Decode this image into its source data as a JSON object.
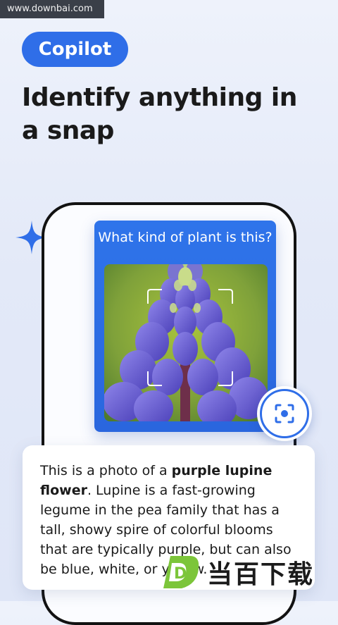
{
  "watermark": {
    "text": "www.downbai.com"
  },
  "badge": {
    "label": "Copilot"
  },
  "headline": {
    "text": "Identify anything in a snap"
  },
  "question_card": {
    "question": "What kind of plant is this?"
  },
  "answer": {
    "intro": "This is a photo of a ",
    "highlight": "purple lupine flower",
    "rest": ". Lupine is a fast-growing legume in the pea family that has a tall, showy spire of colorful blooms that are typically purple, but can also be blue, white, or yellow."
  },
  "brand": {
    "text": "当百下载",
    "logo_letter": "D"
  },
  "icons": {
    "sparkle": "sparkle-icon",
    "scan": "camera-scan-icon"
  },
  "colors": {
    "accent": "#2f6ee8",
    "card_blue": "#2a6ae3",
    "lupine": "#6a5ad8"
  }
}
